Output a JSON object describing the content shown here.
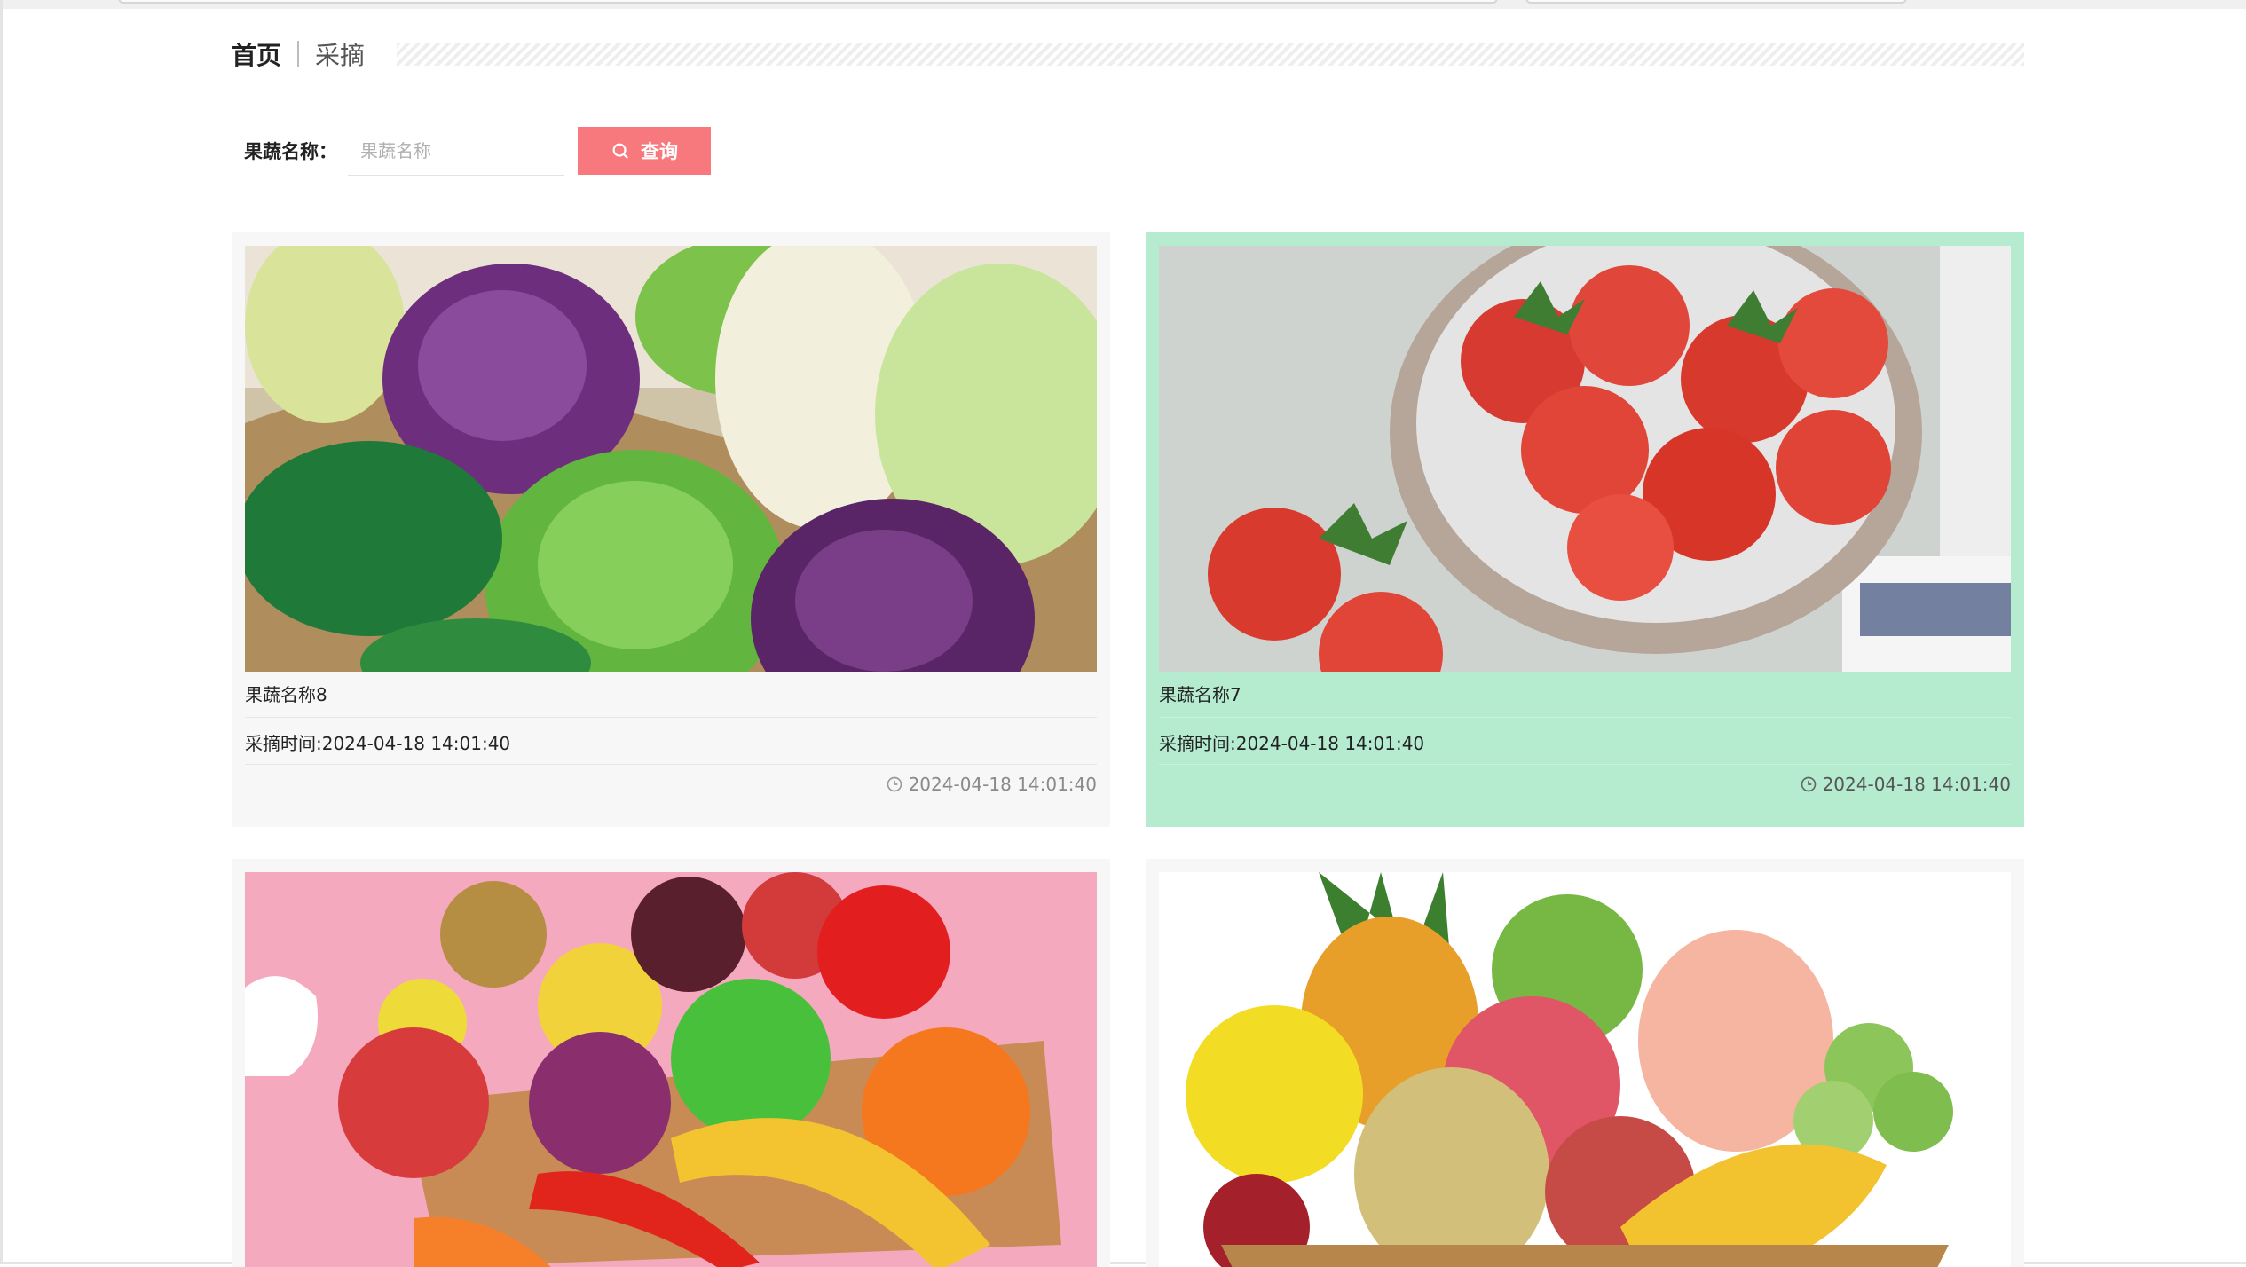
{
  "breadcrumb": {
    "home": "首页",
    "current": "采摘"
  },
  "search": {
    "label": "果蔬名称：",
    "placeholder": "果蔬名称",
    "value": "",
    "button_label": "查询"
  },
  "colors": {
    "accent": "#f7797d",
    "active_card": "#b5ecd0",
    "card_bg": "#f7f7f7"
  },
  "cards": [
    {
      "name": "果蔬名称8",
      "pick_time": "采摘时间:2024-04-18 14:01:40",
      "date": "2024-04-18 14:01:40",
      "image": "cabbages-basket",
      "active": false
    },
    {
      "name": "果蔬名称7",
      "pick_time": "采摘时间:2024-04-18 14:01:40",
      "date": "2024-04-18 14:01:40",
      "image": "strawberries-bowl",
      "active": true
    },
    {
      "name": "",
      "pick_time": "",
      "date": "",
      "image": "fruit-tray-pink",
      "active": false
    },
    {
      "name": "",
      "pick_time": "",
      "date": "",
      "image": "fruit-basket-white",
      "active": false
    }
  ]
}
